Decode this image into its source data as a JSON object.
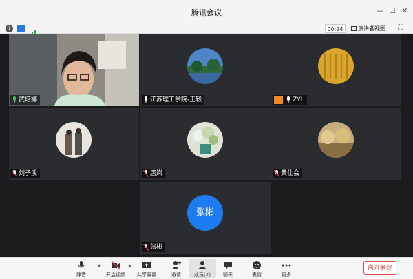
{
  "app": {
    "title": "腾讯会议"
  },
  "infobar": {
    "timer": "00:24",
    "view_label": "演讲者视图"
  },
  "participants": [
    {
      "name": "武培娜"
    },
    {
      "name": "江苏理工学院-王毅"
    },
    {
      "name": "ZYL"
    },
    {
      "name": "刘子溪"
    },
    {
      "name": "唐岚"
    },
    {
      "name": "黄仕会"
    },
    {
      "name": "张彬",
      "avatar_text": "张彬"
    }
  ],
  "toolbar": {
    "mute": "静音",
    "video": "开启视频",
    "share": "共享屏幕",
    "invite": "邀请",
    "members": "成员(7)",
    "chat": "聊天",
    "emoji": "表情",
    "more": "更多",
    "leave": "离开会议"
  },
  "colors": {
    "active_speaker": "#2ea44f",
    "avatar_blue": "#1e7cf2",
    "leave_red": "#e03b3b"
  }
}
